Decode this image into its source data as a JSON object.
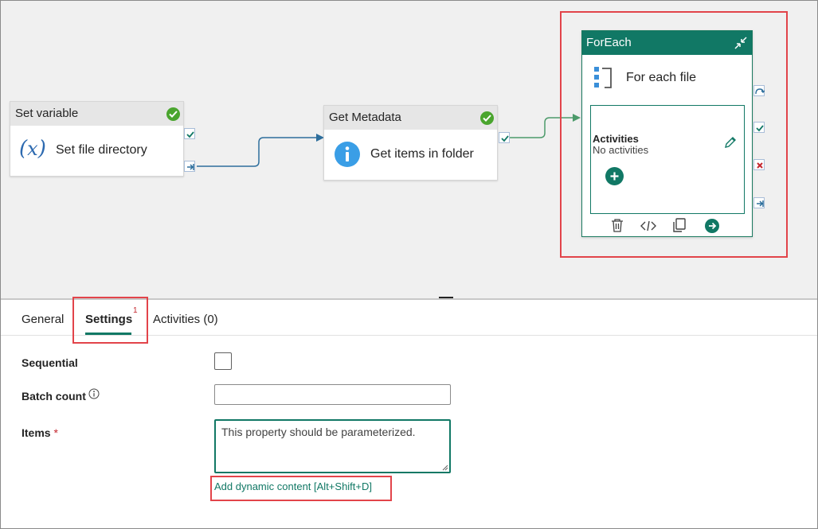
{
  "canvas": {
    "set_variable": {
      "title": "Set variable",
      "label": "Set file directory"
    },
    "get_metadata": {
      "title": "Get Metadata",
      "label": "Get items in folder"
    },
    "foreach": {
      "title": "ForEach",
      "label": "For each file",
      "activities_heading": "Activities",
      "activities_empty": "No activities"
    }
  },
  "tabs": [
    {
      "label": "General"
    },
    {
      "label": "Settings",
      "badge": "1"
    },
    {
      "label": "Activities (0)"
    }
  ],
  "settings": {
    "sequential_label": "Sequential",
    "batch_count_label": "Batch count",
    "items_label": "Items",
    "required_marker": "*",
    "items_value": "This property should be parameterized.",
    "dynamic_content_link": "Add dynamic content [Alt+Shift+D]"
  },
  "colors": {
    "accent": "#117865",
    "success": "#4aa52e",
    "error": "#c4262e",
    "highlight": "#e2444a",
    "connector": "#2d6e9c"
  }
}
